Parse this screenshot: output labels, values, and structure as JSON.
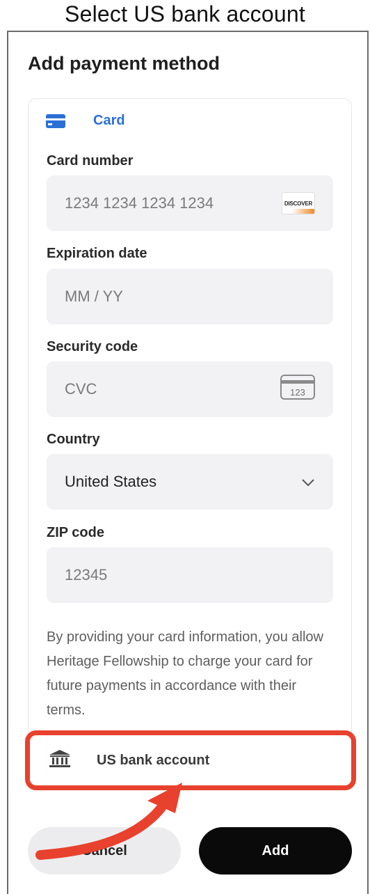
{
  "caption": "Select US bank account",
  "modal": {
    "title": "Add payment method",
    "card_tab": {
      "label": "Card",
      "icon": "credit-card-icon",
      "color": "#2b6fd6"
    },
    "fields": {
      "card_number": {
        "label": "Card number",
        "placeholder": "1234 1234 1234 1234",
        "brand_badge": "DISCOVER"
      },
      "expiration": {
        "label": "Expiration date",
        "placeholder": "MM / YY"
      },
      "security": {
        "label": "Security code",
        "placeholder": "CVC",
        "icon_text": "123"
      },
      "country": {
        "label": "Country",
        "value": "United States"
      },
      "zip": {
        "label": "ZIP code",
        "placeholder": "12345"
      }
    },
    "consent": "By providing your card information, you allow Heritage Fellowship to charge your card for future payments in accordance with their terms.",
    "bank_option": {
      "label": "US bank account",
      "icon": "bank-icon"
    },
    "buttons": {
      "cancel": "Cancel",
      "add": "Add"
    }
  },
  "highlight_color": "#e8412d"
}
